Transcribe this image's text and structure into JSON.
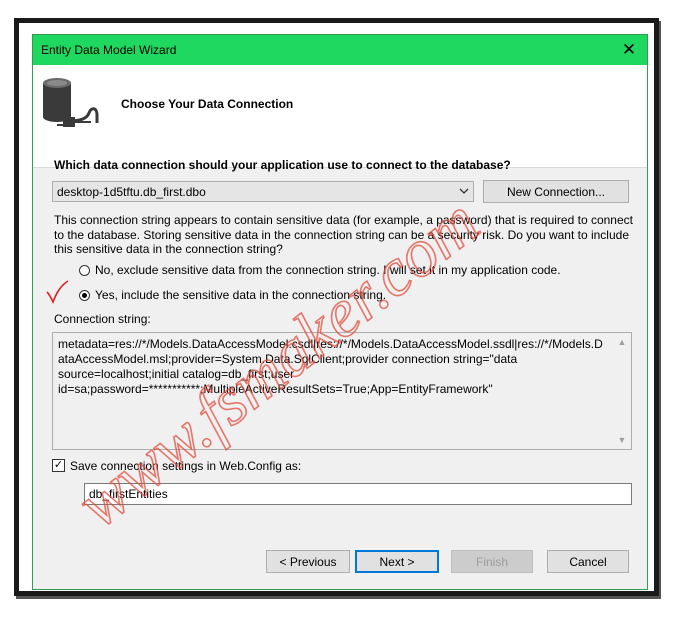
{
  "window": {
    "title": "Entity Data Model Wizard",
    "close_glyph": "✕"
  },
  "header": {
    "title": "Choose Your Data Connection",
    "icon": "database-plug-icon"
  },
  "question": "Which data connection should your application use to connect to the database?",
  "connection": {
    "selected": "desktop-1d5tftu.db_first.dbo",
    "new_button": "New Connection..."
  },
  "sensitive_text": "This connection string appears to contain sensitive data (for example, a password) that is required to connect to the database. Storing sensitive data in the connection string can be a security risk. Do you want to include this sensitive data in the connection string?",
  "options": {
    "exclude": {
      "label": "No, exclude sensitive data from the connection string. I will set it in my application code.",
      "checked": false
    },
    "include": {
      "label": "Yes, include the sensitive data in the connection string.",
      "checked": true
    }
  },
  "connection_string": {
    "label": "Connection string:",
    "value": "metadata=res://*/Models.DataAccessModel.csdl|res://*/Models.DataAccessModel.ssdl|res://*/Models.DataAccessModel.msl;provider=System.Data.SqlClient;provider connection string=\"data source=localhost;initial catalog=db_first;user id=sa;password=***********;MultipleActiveResultSets=True;App=EntityFramework\""
  },
  "save_settings": {
    "label": "Save connection settings in Web.Config as:",
    "checked": true,
    "check_glyph": "✓",
    "entity_name": "db_firstEntities"
  },
  "buttons": {
    "previous": "< Previous",
    "next": "Next >",
    "finish": "Finish",
    "cancel": "Cancel"
  },
  "watermark": "www.fsmaker.com",
  "colors": {
    "titlebar": "#1fd860",
    "watermark": "#e04c3c",
    "annotation": "#e02020"
  }
}
